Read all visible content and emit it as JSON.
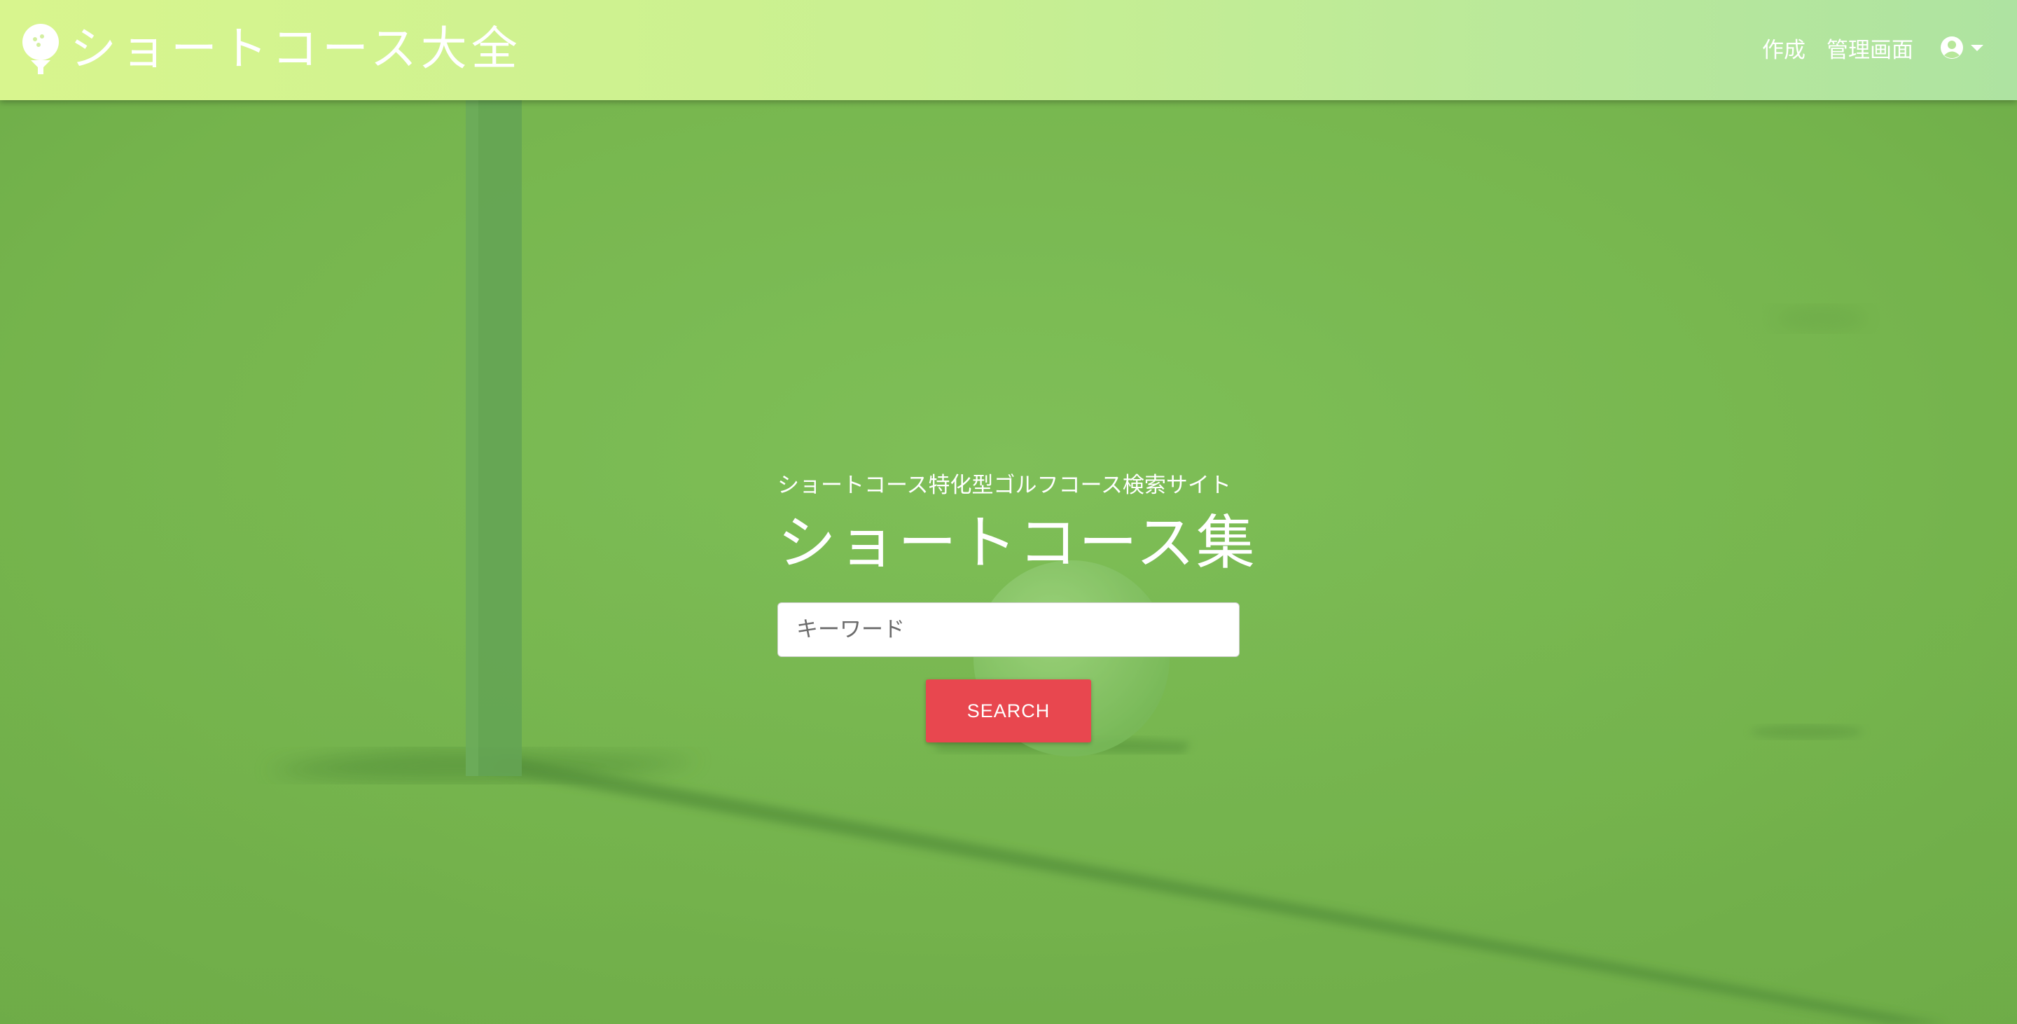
{
  "navbar": {
    "brand_icon": "golf-ball-on-tee-icon",
    "brand_text": "ショートコース大全",
    "links": [
      {
        "label": "作成"
      },
      {
        "label": "管理画面"
      }
    ],
    "user_icon": "user-circle-icon"
  },
  "hero": {
    "background": "golf-green-with-flagstick-and-ball-photo",
    "subtitle": "ショートコース特化型ゴルフコース検索サイト",
    "title": "ショートコース集",
    "search": {
      "value": "",
      "placeholder": "キーワード"
    },
    "search_button_label": "SEARCH"
  },
  "colors": {
    "navbar_gradient_start": "#d8f58e",
    "navbar_gradient_end": "#aee3a1",
    "search_button": "#e8474f",
    "grass": "#79b44f"
  }
}
